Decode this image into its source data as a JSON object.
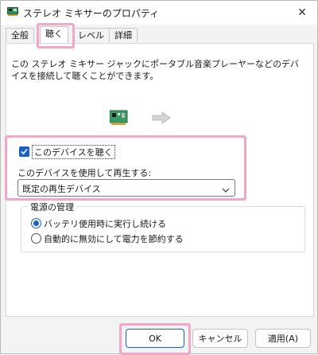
{
  "window": {
    "title": "ステレオ ミキサーのプロパティ",
    "close_glyph": "✕"
  },
  "tabs": [
    {
      "label": "全般",
      "active": false
    },
    {
      "label": "聴く",
      "active": true
    },
    {
      "label": "レベル",
      "active": false
    },
    {
      "label": "詳細",
      "active": false
    }
  ],
  "listen": {
    "description": "この ステレオ ミキサー ジャックにポータブル音楽プレーヤーなどのデバイスを接続して聴くことができます。",
    "listen_checkbox_label": "このデバイスを聴く",
    "listen_checked": true,
    "playback_label": "このデバイスを使用して再生する:",
    "playback_device_value": "既定の再生デバイス"
  },
  "power": {
    "group_title": "電源の管理",
    "options": [
      {
        "label": "バッテリ使用時に実行し続ける",
        "selected": true
      },
      {
        "label": "自動的に無効にして電力を節約する",
        "selected": false
      }
    ]
  },
  "footer": {
    "ok_label": "OK",
    "cancel_label": "キャンセル",
    "apply_label": "適用(A)"
  },
  "colors": {
    "accent": "#1a60c7",
    "highlight": "#f2a7c8"
  }
}
